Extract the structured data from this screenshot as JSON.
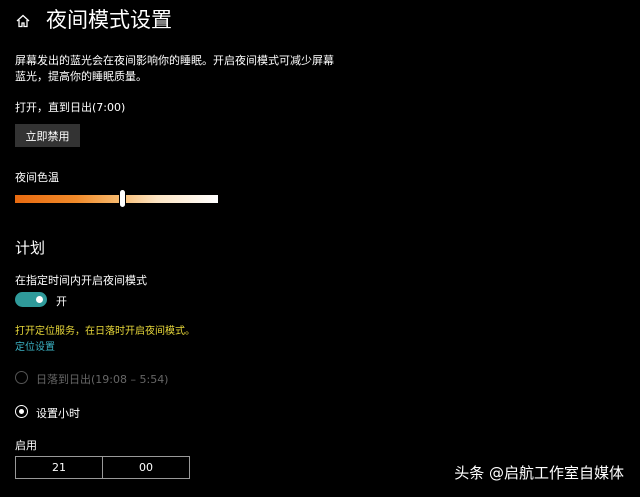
{
  "header": {
    "title": "夜间模式设置",
    "home_icon": "home-icon"
  },
  "description": {
    "line1": "屏幕发出的蓝光会在夜间影响你的睡眠。开启夜间模式可减少屏幕",
    "line2": "蓝光，提高你的睡眠质量。"
  },
  "status": "打开，直到日出(7:00)",
  "disable_button_label": "立即禁用",
  "color_temp": {
    "label": "夜间色温",
    "level": 0.53
  },
  "schedule": {
    "title": "计划",
    "toggle_label_heading": "在指定时间内开启夜间模式",
    "toggle_state": "开",
    "warning": "打开定位服务，在日落时开启夜间模式。",
    "location_link": "定位设置",
    "options": [
      {
        "label": "日落到日出",
        "detail": "(19:08 – 5:54)",
        "selected": false,
        "disabled": true
      },
      {
        "label": "设置小时",
        "detail": "",
        "selected": true,
        "disabled": false
      }
    ],
    "enable_label": "启用",
    "time": {
      "hour": "21",
      "minute": "00"
    }
  },
  "watermark": "头条 @启航工作室自媒体",
  "colors": {
    "background": "#000000",
    "accent": "#2f9a9a",
    "warning": "#e8d83a",
    "link": "#3bb3c5"
  }
}
